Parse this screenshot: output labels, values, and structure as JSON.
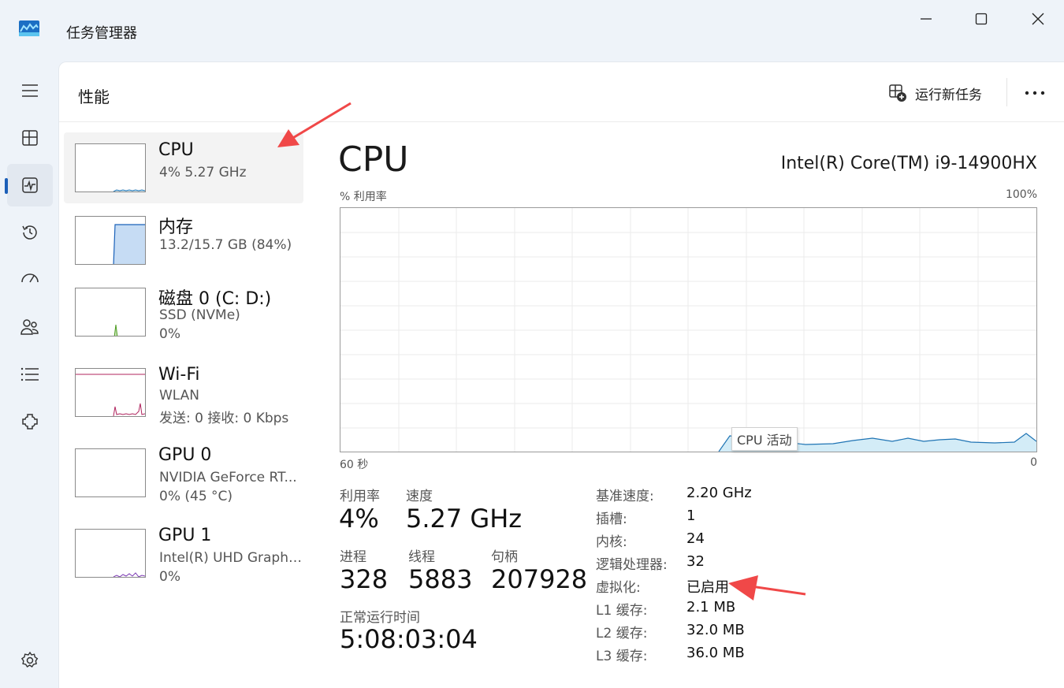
{
  "window": {
    "title": "任务管理器",
    "minimize_icon": "minimize-icon",
    "maximize_icon": "maximize-icon",
    "close_icon": "close-icon"
  },
  "nav": {
    "items": [
      {
        "icon": "hamburger-menu-icon"
      },
      {
        "icon": "processes-icon"
      },
      {
        "icon": "performance-icon",
        "active": true
      },
      {
        "icon": "app-history-icon"
      },
      {
        "icon": "startup-apps-icon"
      },
      {
        "icon": "users-icon"
      },
      {
        "icon": "details-icon"
      },
      {
        "icon": "services-icon"
      },
      {
        "icon": "settings-icon"
      }
    ]
  },
  "header": {
    "title": "性能",
    "run_task_label": "运行新任务",
    "run_task_icon": "new-task-icon",
    "more_icon": "more-options-icon"
  },
  "sidebar": {
    "items": [
      {
        "name": "CPU",
        "line1": "4%  5.27 GHz",
        "line2": "",
        "color": "#1f74b4",
        "selected": true
      },
      {
        "name": "内存",
        "line1": "13.2/15.7 GB (84%)",
        "line2": "",
        "color": "#1b62b9"
      },
      {
        "name": "磁盘 0 (C: D:)",
        "line1": "SSD (NVMe)",
        "line2": "0%",
        "color": "#4b9a1f"
      },
      {
        "name": "Wi-Fi",
        "line1": "WLAN",
        "line2": "发送: 0 接收: 0 Kbps",
        "color": "#b0245e"
      },
      {
        "name": "GPU 0",
        "line1": "NVIDIA GeForce RT...",
        "line2": "0%  (45 °C)",
        "color": "#7d3cb5"
      },
      {
        "name": "GPU 1",
        "line1": "Intel(R) UHD Graphics",
        "line2": "0%",
        "color": "#7d3cb5"
      }
    ]
  },
  "detail": {
    "title": "CPU",
    "model": "Intel(R) Core(TM) i9-14900HX",
    "graph": {
      "y_label": "% 利用率",
      "y_max_label": "100%",
      "x_left_label": "60 秒",
      "x_right_label": "0",
      "tooltip": "CPU 活动",
      "line_color": "#1f74b4",
      "fill_color": "#d3ecf7"
    },
    "stats": {
      "util_label": "利用率",
      "util_value": "4%",
      "speed_label": "速度",
      "speed_value": "5.27 GHz",
      "proc_label": "进程",
      "proc_value": "328",
      "thread_label": "线程",
      "thread_value": "5883",
      "handle_label": "句柄",
      "handle_value": "207928",
      "uptime_label": "正常运行时间",
      "uptime_value": "5:08:03:04"
    },
    "specs": [
      {
        "label": "基准速度:",
        "value": "2.20 GHz"
      },
      {
        "label": "插槽:",
        "value": "1"
      },
      {
        "label": "内核:",
        "value": "24"
      },
      {
        "label": "逻辑处理器:",
        "value": "32"
      },
      {
        "label": "虚拟化:",
        "value": "已启用"
      },
      {
        "label": "L1 缓存:",
        "value": "2.1 MB"
      },
      {
        "label": "L2 缓存:",
        "value": "32.0 MB"
      },
      {
        "label": "L3 缓存:",
        "value": "36.0 MB"
      }
    ]
  },
  "annotation": {
    "arrow_color": "#f04848"
  }
}
